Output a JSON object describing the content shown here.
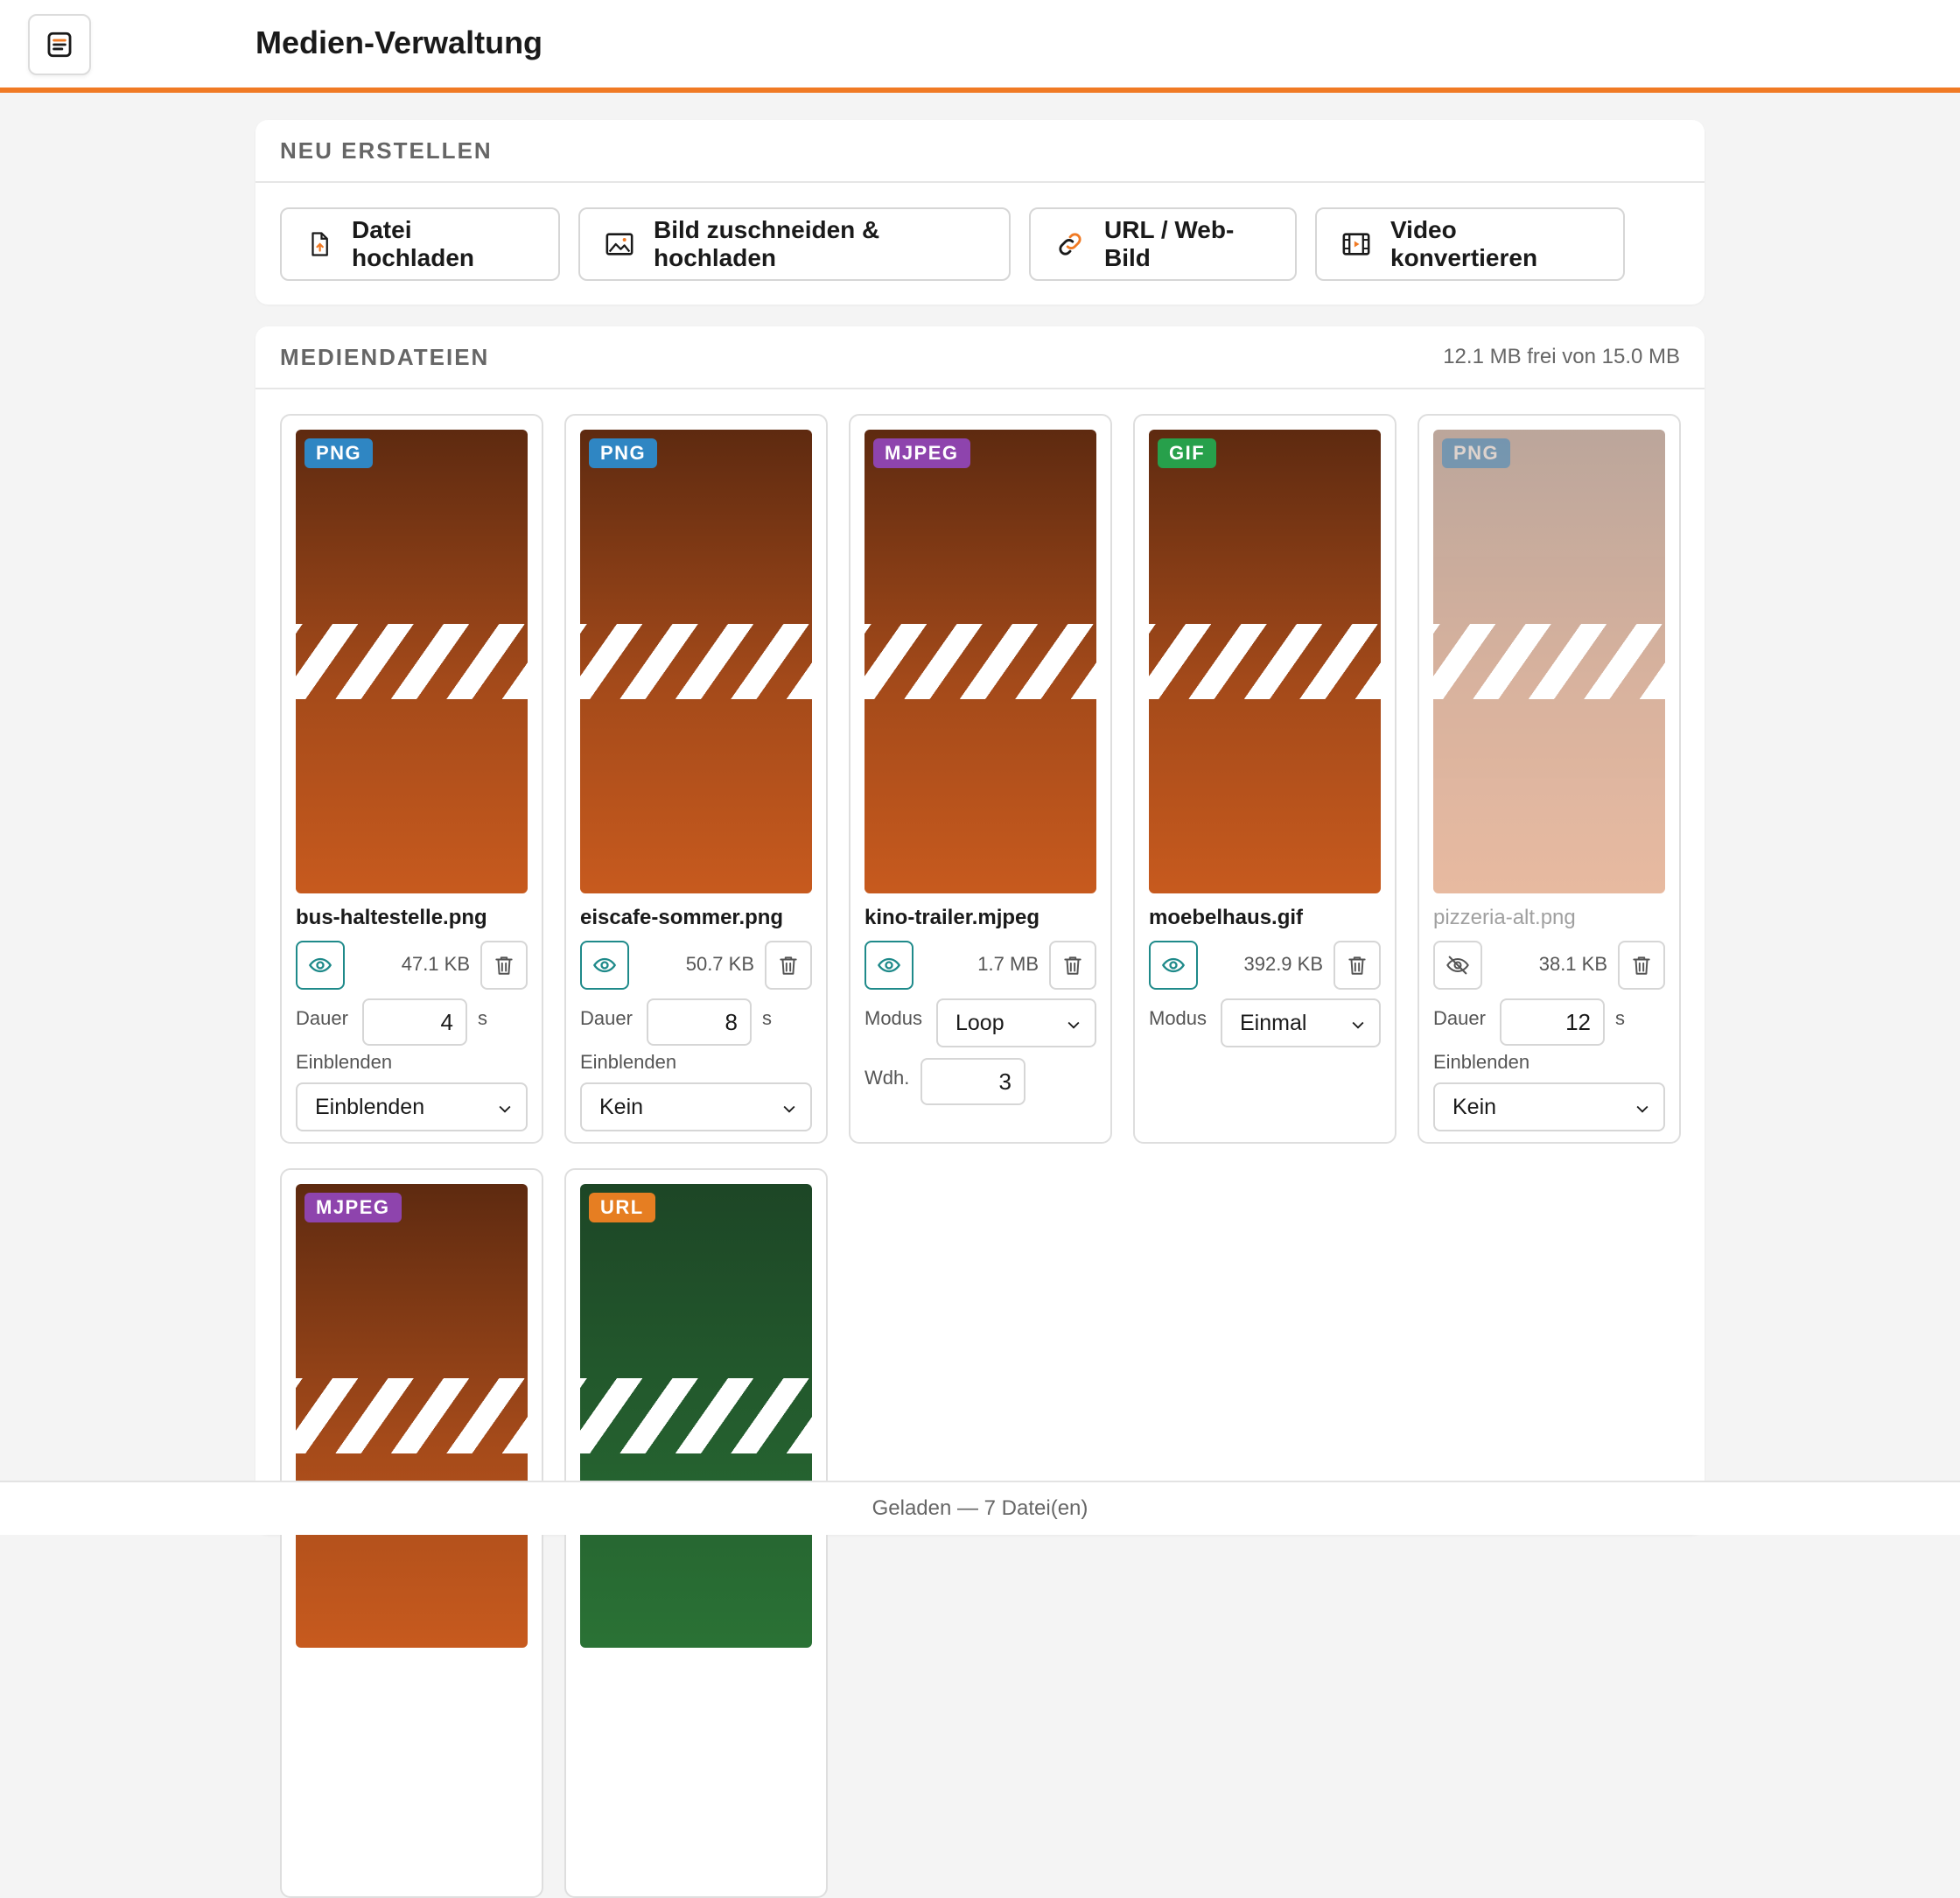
{
  "header": {
    "title": "Medien-Verwaltung"
  },
  "create": {
    "title": "NEU ERSTELLEN",
    "buttons": [
      {
        "label": "Datei hochladen",
        "icon": "file-upload-icon"
      },
      {
        "label": "Bild zuschneiden & hochladen",
        "icon": "image-crop-icon"
      },
      {
        "label": "URL / Web-Bild",
        "icon": "link-icon"
      },
      {
        "label": "Video konvertieren",
        "icon": "film-icon"
      }
    ]
  },
  "media": {
    "title": "MEDIENDATEIEN",
    "storage": "12.1 MB frei von 15.0 MB",
    "items": [
      {
        "type": "PNG",
        "type_color": "#2f86c3",
        "name": "bus-haltestelle.png",
        "size": "47.1 KB",
        "visible": true,
        "dauer_label": "Dauer",
        "dauer": "4",
        "unit": "s",
        "einblenden_label": "Einblenden",
        "einblenden": "Einblenden"
      },
      {
        "type": "PNG",
        "type_color": "#2f86c3",
        "name": "eiscafe-sommer.png",
        "size": "50.7 KB",
        "visible": true,
        "dauer_label": "Dauer",
        "dauer": "8",
        "unit": "s",
        "einblenden_label": "Einblenden",
        "einblenden": "Kein"
      },
      {
        "type": "MJPEG",
        "type_color": "#8e44ad",
        "name": "kino-trailer.mjpeg",
        "size": "1.7 MB",
        "visible": true,
        "modus_label": "Modus",
        "modus": "Loop",
        "wdh_label": "Wdh.",
        "wdh": "3"
      },
      {
        "type": "GIF",
        "type_color": "#27a04b",
        "name": "moebelhaus.gif",
        "size": "392.9 KB",
        "visible": true,
        "modus_label": "Modus",
        "modus": "Einmal"
      },
      {
        "type": "PNG",
        "type_color": "#2f86c3",
        "name": "pizzeria-alt.png",
        "size": "38.1 KB",
        "visible": false,
        "dauer_label": "Dauer",
        "dauer": "12",
        "unit": "s",
        "einblenden_label": "Einblenden",
        "einblenden": "Kein"
      },
      {
        "type": "MJPEG",
        "type_color": "#8e44ad"
      },
      {
        "type": "URL",
        "type_color": "#e67e22"
      }
    ]
  },
  "status": "Geladen — 7 Datei(en)"
}
